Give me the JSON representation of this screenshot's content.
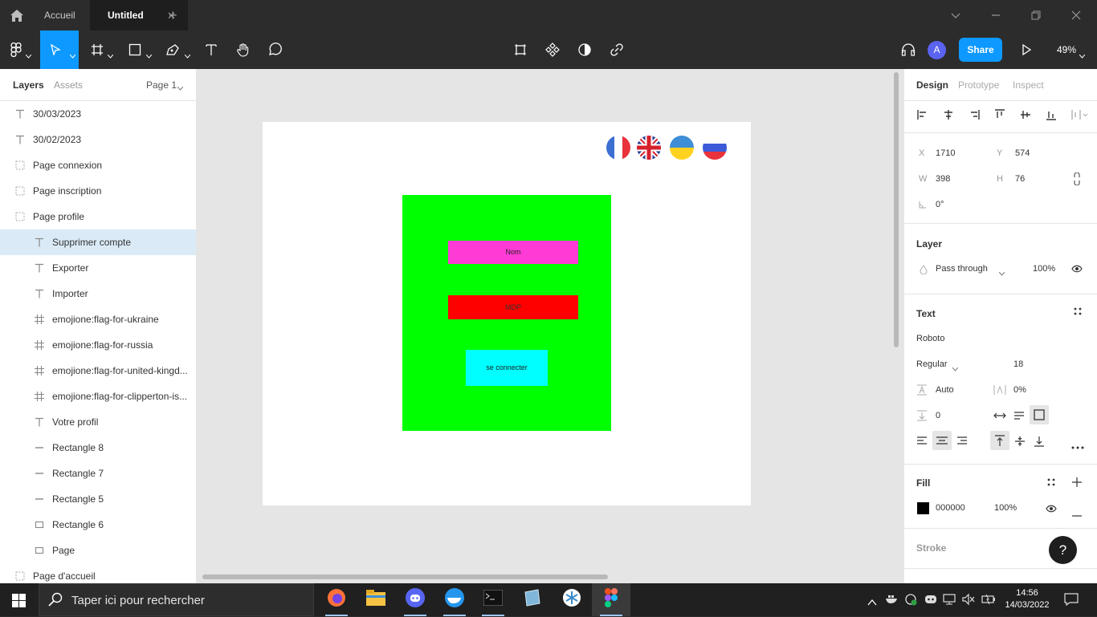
{
  "titlebar": {
    "tabs": [
      {
        "label": "Accueil"
      },
      {
        "label": "Untitled",
        "close": "✕"
      }
    ],
    "add_tab": "+"
  },
  "toolbar": {
    "share_label": "Share",
    "avatar_letter": "A",
    "zoom": "49%"
  },
  "left_panel": {
    "tabs": {
      "layers": "Layers",
      "assets": "Assets",
      "page": "Page 1"
    },
    "layers": [
      {
        "name": "30/03/2023",
        "icon": "text-icon"
      },
      {
        "name": "30/02/2023",
        "icon": "text-icon"
      },
      {
        "name": "Page connexion",
        "icon": "section-icon"
      },
      {
        "name": "Page inscription",
        "icon": "section-icon"
      },
      {
        "name": "Page profile",
        "icon": "section-icon"
      },
      {
        "name": "Supprimer compte",
        "icon": "text-icon"
      },
      {
        "name": "Exporter",
        "icon": "text-icon"
      },
      {
        "name": "Importer",
        "icon": "text-icon"
      },
      {
        "name": "emojione:flag-for-ukraine",
        "icon": "frame-icon"
      },
      {
        "name": "emojione:flag-for-russia",
        "icon": "frame-icon"
      },
      {
        "name": "emojione:flag-for-united-kingd...",
        "icon": "frame-icon"
      },
      {
        "name": "emojione:flag-for-clipperton-is...",
        "icon": "frame-icon"
      },
      {
        "name": "Votre profil",
        "icon": "text-icon"
      },
      {
        "name": "Rectangle 8",
        "icon": "line-icon"
      },
      {
        "name": "Rectangle 7",
        "icon": "line-icon"
      },
      {
        "name": "Rectangle 5",
        "icon": "line-icon"
      },
      {
        "name": "Rectangle 6",
        "icon": "rectangle-icon"
      },
      {
        "name": "Page",
        "icon": "rectangle-icon"
      },
      {
        "name": "Page d'accueil",
        "icon": "section-icon"
      }
    ]
  },
  "canvas": {
    "nom_label": "Nom",
    "mdp_label": "MDP",
    "connect_label": "se connecter",
    "colors": {
      "green": "#00ff00",
      "pink": "#ff3bd6",
      "red": "#ff0000",
      "cyan": "#00ffff"
    }
  },
  "right_panel": {
    "tabs": {
      "design": "Design",
      "prototype": "Prototype",
      "inspect": "Inspect"
    },
    "x_label": "X",
    "x_value": "1710",
    "y_label": "Y",
    "y_value": "574",
    "w_label": "W",
    "w_value": "398",
    "h_label": "H",
    "h_value": "76",
    "rotation": "0°",
    "layer_title": "Layer",
    "blend_mode": "Pass through",
    "layer_opacity": "100%",
    "text_title": "Text",
    "font_family": "Roboto",
    "font_weight": "Regular",
    "font_size": "18",
    "line_height": "Auto",
    "letter_spacing": "0%",
    "paragraph_spacing": "0",
    "fill_title": "Fill",
    "fill_hex": "000000",
    "fill_opacity": "100%",
    "stroke_title": "Stroke",
    "help": "?"
  },
  "taskbar": {
    "search_placeholder": "Taper ici pour rechercher",
    "time": "14:56",
    "date": "14/03/2022"
  }
}
